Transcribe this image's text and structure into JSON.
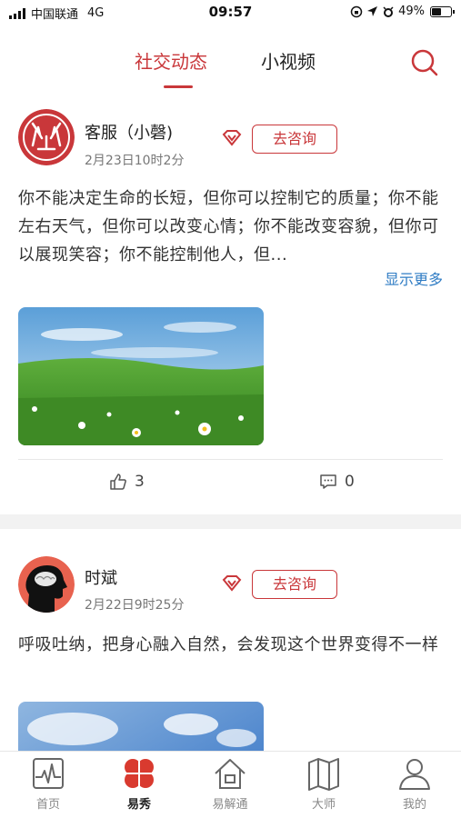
{
  "status_bar": {
    "carrier": "中国联通",
    "network": "4G",
    "time": "09:57",
    "battery": "49%"
  },
  "top_nav": {
    "tabs": [
      {
        "label": "社交动态",
        "active": true
      },
      {
        "label": "小视频",
        "active": false
      }
    ],
    "search_icon": "search-icon",
    "accent_color": "#c9373a"
  },
  "posts": [
    {
      "username": "客服（小磬)",
      "date": "2月23日10时2分",
      "consult_label": "去咨询",
      "text": "你不能决定生命的长短，但你可以控制它的质量；你不能左右天气，但你可以改变心情；你不能改变容貌，但你可以展现笑容；你不能控制他人，但...",
      "show_more": "显示更多",
      "likes": "3",
      "comments": "0"
    },
    {
      "username": "时斌",
      "date": "2月22日9时25分",
      "consult_label": "去咨询",
      "text": "呼吸吐纳，把身心融入自然，会发现这个世界变得不一样"
    }
  ],
  "bottom_nav": {
    "items": [
      {
        "label": "首页",
        "icon": "heartbeat-icon",
        "active": false
      },
      {
        "label": "易秀",
        "icon": "clover-icon",
        "active": true
      },
      {
        "label": "易解通",
        "icon": "house-icon",
        "active": false
      },
      {
        "label": "大师",
        "icon": "map-icon",
        "active": false
      },
      {
        "label": "我的",
        "icon": "person-icon",
        "active": false
      }
    ]
  }
}
